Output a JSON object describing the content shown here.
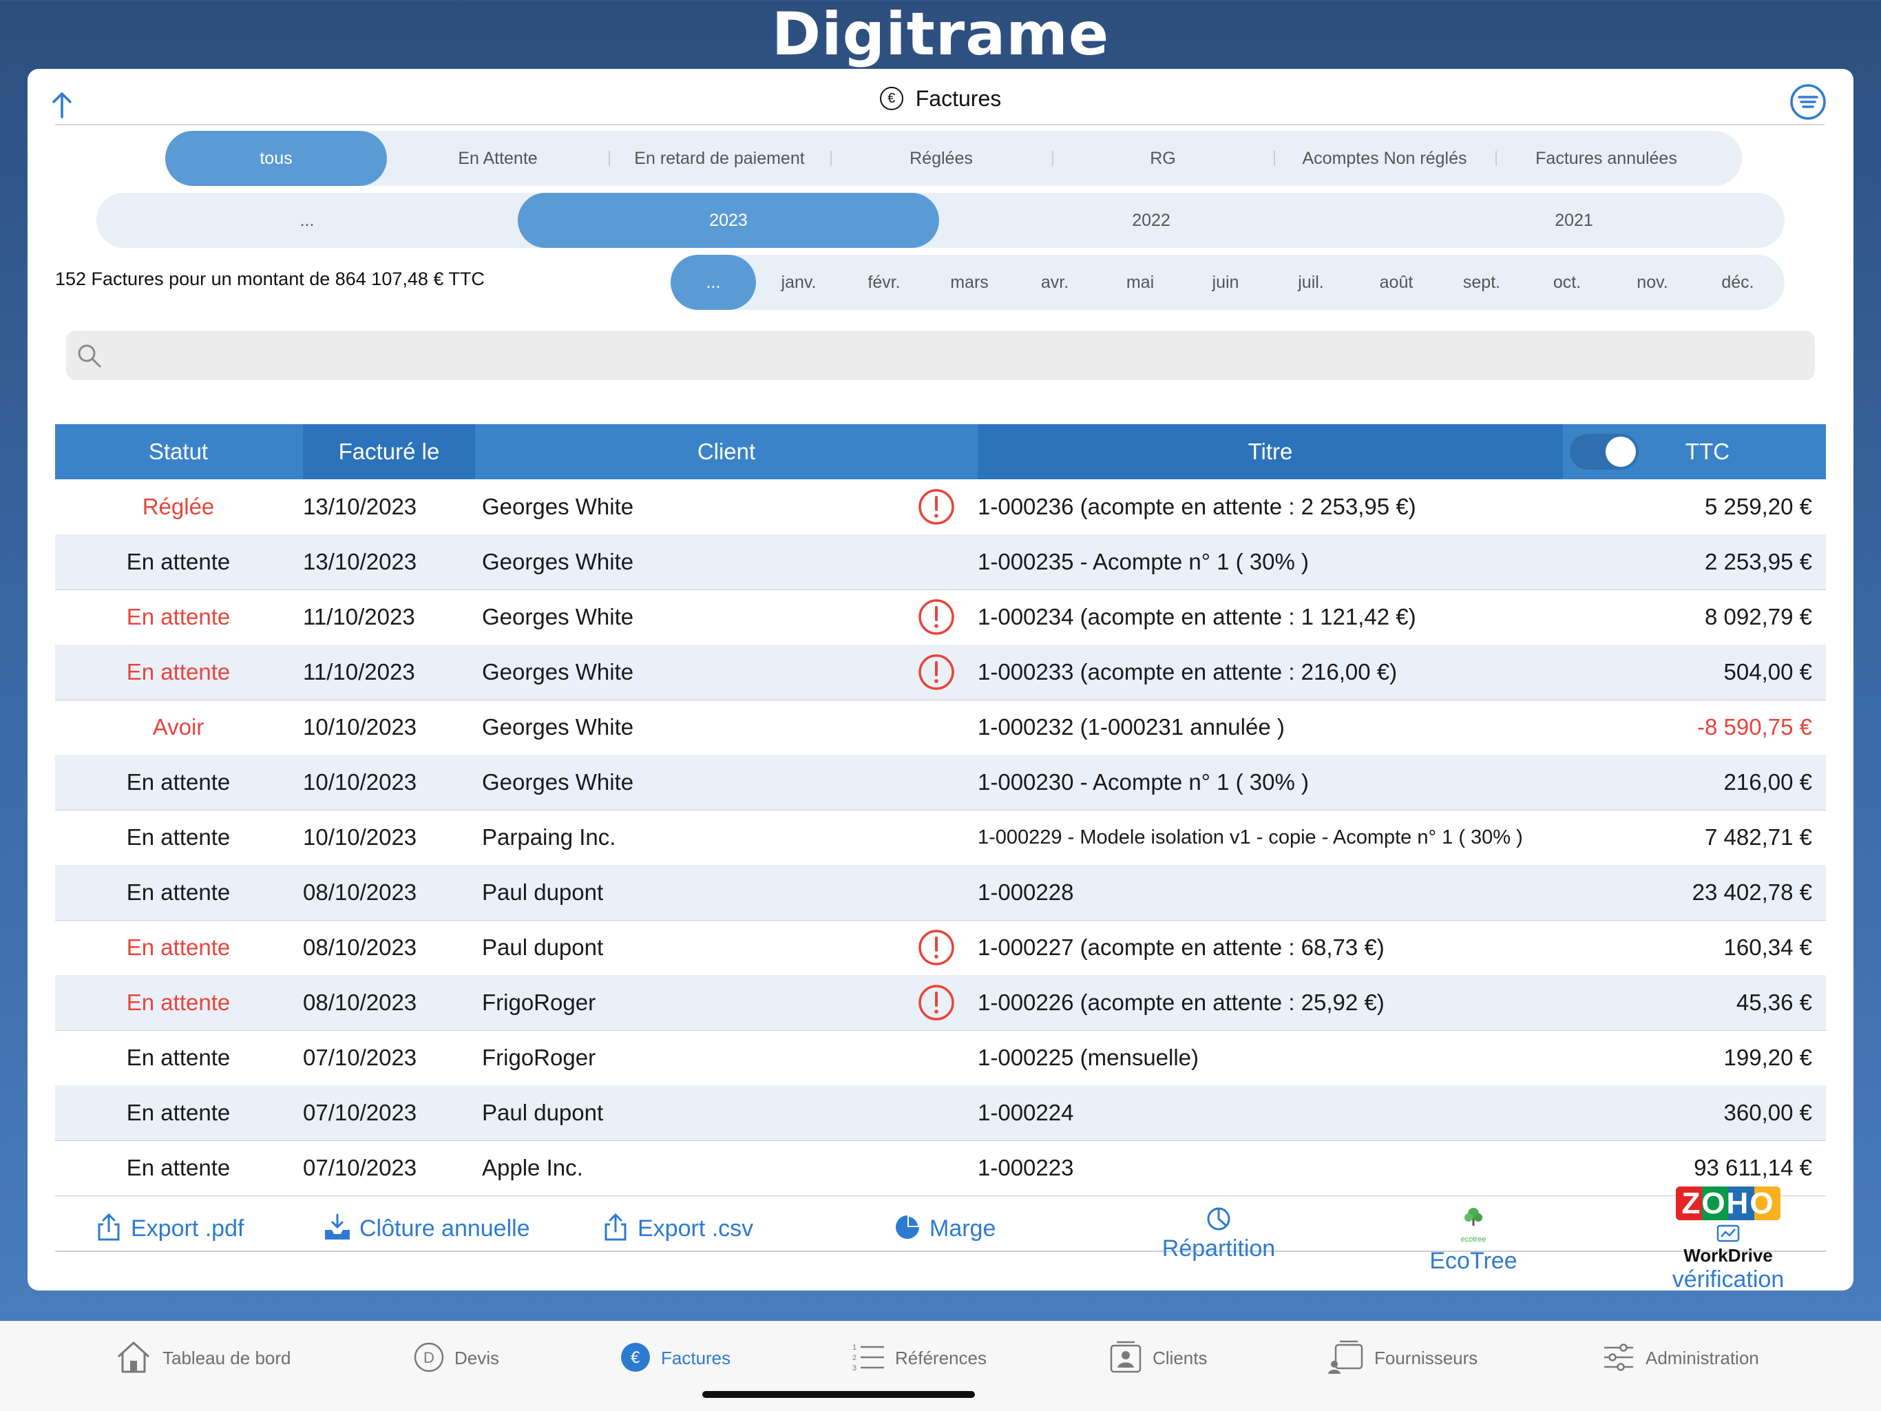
{
  "app": {
    "brand": "Digitrame"
  },
  "panel": {
    "title": "Factures",
    "title_icon": "euro-circle-icon"
  },
  "status_filter": {
    "options": [
      "tous",
      "En Attente",
      "En retard de paiement",
      "Réglées",
      "RG",
      "Acomptes Non réglés",
      "Factures annulées"
    ],
    "selected": "tous"
  },
  "year_filter": {
    "options": [
      "...",
      "2023",
      "2022",
      "2021"
    ],
    "selected": "2023"
  },
  "month_filter": {
    "options": [
      "...",
      "janv.",
      "févr.",
      "mars",
      "avr.",
      "mai",
      "juin",
      "juil.",
      "août",
      "sept.",
      "oct.",
      "nov.",
      "déc."
    ],
    "selected": "..."
  },
  "summary": "152 Factures pour un montant de 864 107,48 € TTC",
  "search": {
    "placeholder": "",
    "value": ""
  },
  "table": {
    "headers": {
      "statut": "Statut",
      "facture_le": "Facturé le",
      "client": "Client",
      "titre": "Titre",
      "ttc": "TTC"
    },
    "ttc_toggle_on": true,
    "rows": [
      {
        "statut": "Réglée",
        "status_red": true,
        "date": "13/10/2023",
        "client": "Georges White",
        "warning": true,
        "titre": "1-000236 (acompte en attente : 2 253,95 €)",
        "ttc": "5 259,20 €",
        "ttc_red": false
      },
      {
        "statut": "En attente",
        "status_red": false,
        "date": "13/10/2023",
        "client": "Georges White",
        "warning": false,
        "titre": "1-000235 - Acompte n° 1  ( 30% )",
        "ttc": "2 253,95 €",
        "ttc_red": false
      },
      {
        "statut": "En attente",
        "status_red": true,
        "date": "11/10/2023",
        "client": "Georges White",
        "warning": true,
        "titre": "1-000234 (acompte en attente : 1 121,42 €)",
        "ttc": "8 092,79 €",
        "ttc_red": false
      },
      {
        "statut": "En attente",
        "status_red": true,
        "date": "11/10/2023",
        "client": "Georges White",
        "warning": true,
        "titre": "1-000233 (acompte en attente : 216,00 €)",
        "ttc": "504,00 €",
        "ttc_red": false
      },
      {
        "statut": "Avoir",
        "status_red": true,
        "date": "10/10/2023",
        "client": "Georges White",
        "warning": false,
        "titre": "1-000232   (1-000231 annulée )",
        "ttc": "-8 590,75 €",
        "ttc_red": true
      },
      {
        "statut": "En attente",
        "status_red": false,
        "date": "10/10/2023",
        "client": "Georges White",
        "warning": false,
        "titre": "1-000230 - Acompte n° 1  ( 30% )",
        "ttc": "216,00 €",
        "ttc_red": false
      },
      {
        "statut": "En attente",
        "status_red": false,
        "date": "10/10/2023",
        "client": "Parpaing Inc.",
        "warning": false,
        "titre": "1-000229 - Modele isolation v1 - copie - Acompte n° 1  ( 30% )",
        "ttc": "7 482,71 €",
        "ttc_red": false,
        "small": true
      },
      {
        "statut": "En attente",
        "status_red": false,
        "date": "08/10/2023",
        "client": "Paul dupont",
        "warning": false,
        "titre": "1-000228",
        "ttc": "23 402,78 €",
        "ttc_red": false
      },
      {
        "statut": "En attente",
        "status_red": true,
        "date": "08/10/2023",
        "client": "Paul dupont",
        "warning": true,
        "titre": "1-000227 (acompte en attente : 68,73 €)",
        "ttc": "160,34 €",
        "ttc_red": false
      },
      {
        "statut": "En attente",
        "status_red": true,
        "date": "08/10/2023",
        "client": "FrigoRoger",
        "warning": true,
        "titre": "1-000226 (acompte en attente : 25,92 €)",
        "ttc": "45,36 €",
        "ttc_red": false
      },
      {
        "statut": "En attente",
        "status_red": false,
        "date": "07/10/2023",
        "client": "FrigoRoger",
        "warning": false,
        "titre": "1-000225   (mensuelle)",
        "ttc": "199,20 €",
        "ttc_red": false
      },
      {
        "statut": "En attente",
        "status_red": false,
        "date": "07/10/2023",
        "client": "Paul dupont",
        "warning": false,
        "titre": "1-000224",
        "ttc": "360,00 €",
        "ttc_red": false
      },
      {
        "statut": "En attente",
        "status_red": false,
        "date": "07/10/2023",
        "client": "Apple Inc.",
        "warning": false,
        "titre": "1-000223",
        "ttc": "93 611,14 €",
        "ttc_red": false
      }
    ]
  },
  "actions": {
    "export_pdf": "Export  .pdf",
    "cloture": "Clôture annuelle",
    "export_csv": "Export  .csv",
    "marge": "Marge",
    "repartition": "Répartition",
    "ecotree": "EcoTree",
    "ecotree_logo_text": "ecotree",
    "zoho_logo": "ZOHO",
    "workdrive": "WorkDrive",
    "verification": "vérification"
  },
  "tabbar": {
    "items": [
      {
        "label": "Tableau de bord",
        "icon": "house-icon"
      },
      {
        "label": "Devis",
        "icon": "d-circle-icon"
      },
      {
        "label": "Factures",
        "icon": "euro-circle-icon",
        "active": true
      },
      {
        "label": "Références",
        "icon": "numbered-list-icon"
      },
      {
        "label": "Clients",
        "icon": "contact-card-icon"
      },
      {
        "label": "Fournisseurs",
        "icon": "supplier-icon"
      },
      {
        "label": "Administration",
        "icon": "sliders-icon"
      }
    ]
  },
  "colors": {
    "accent": "#2d7bd0",
    "header_blue": "#3b83c8",
    "selected_pill": "#5b9bd5",
    "red": "#e8453c",
    "row_alt": "#eaf0f8"
  }
}
